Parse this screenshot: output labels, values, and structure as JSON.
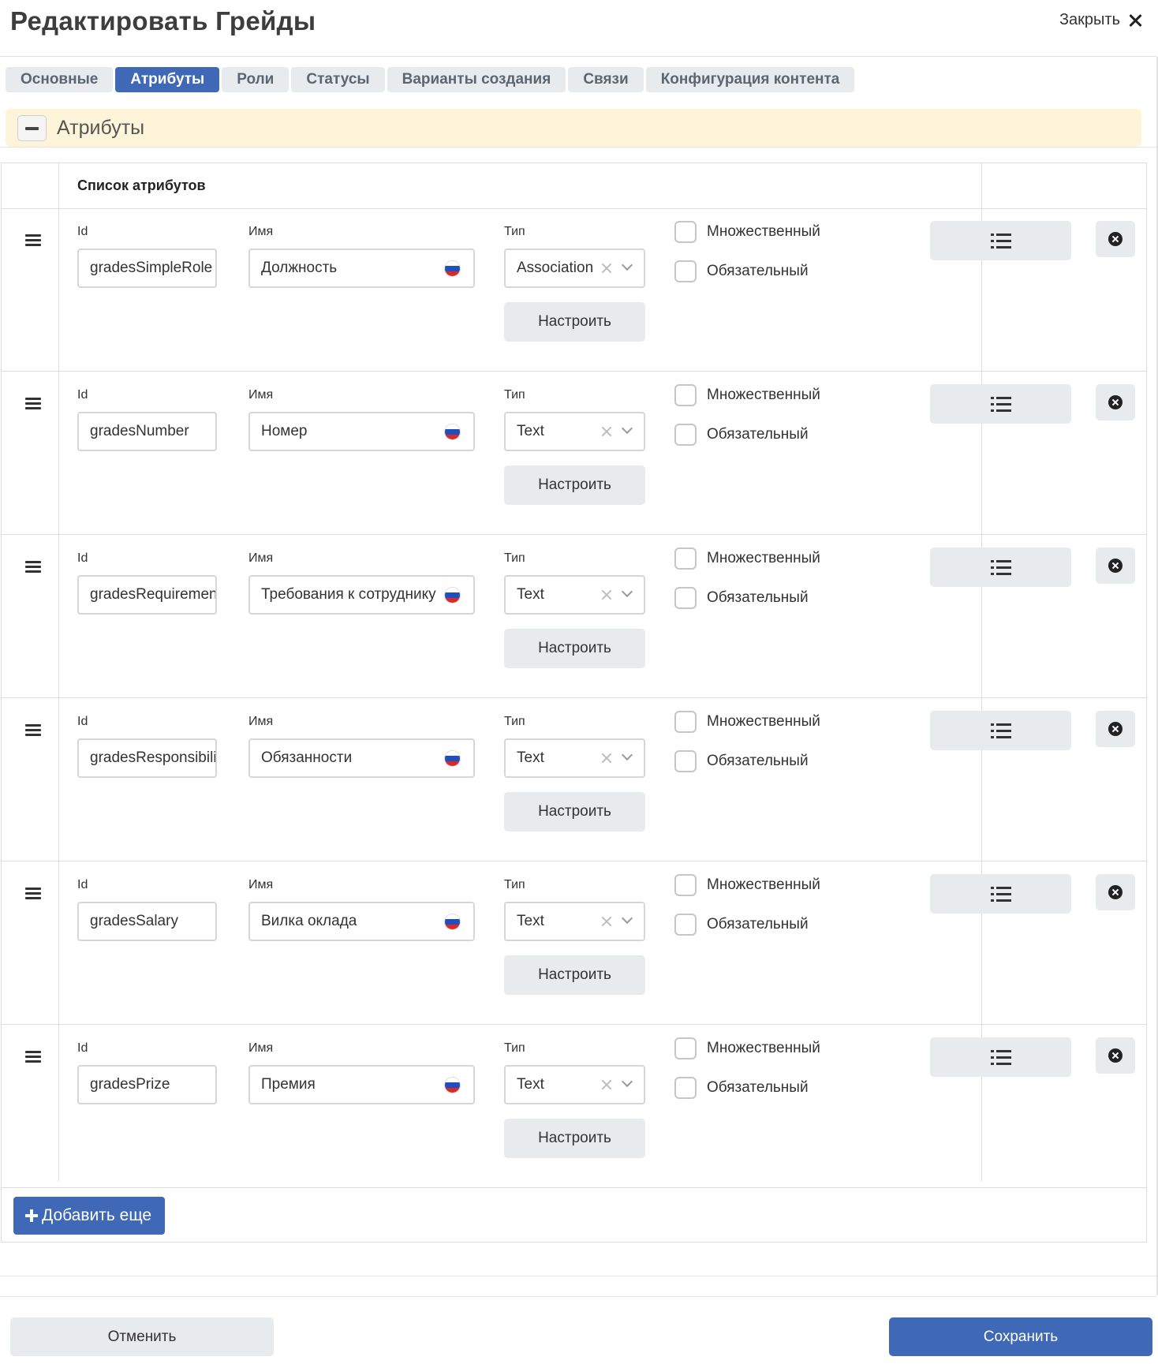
{
  "header": {
    "title": "Редактировать Грейды",
    "close_label": "Закрыть"
  },
  "tabs": [
    {
      "label": "Основные",
      "active": false
    },
    {
      "label": "Атрибуты",
      "active": true
    },
    {
      "label": "Роли",
      "active": false
    },
    {
      "label": "Статусы",
      "active": false
    },
    {
      "label": "Варианты создания",
      "active": false
    },
    {
      "label": "Связи",
      "active": false
    },
    {
      "label": "Конфигурация контента",
      "active": false
    }
  ],
  "section": {
    "title": "Атрибуты"
  },
  "table": {
    "header": "Список атрибутов",
    "labels": {
      "id": "Id",
      "name": "Имя",
      "type": "Тип",
      "configure": "Настроить",
      "multiple": "Множественный",
      "required": "Обязательный"
    },
    "rows": [
      {
        "id": "gradesSimpleRole",
        "name": "Должность",
        "type": "Association",
        "multiple": false,
        "required": false
      },
      {
        "id": "gradesNumber",
        "name": "Номер",
        "type": "Text",
        "multiple": false,
        "required": false
      },
      {
        "id": "gradesRequirements",
        "name": "Требования к сотруднику",
        "type": "Text",
        "multiple": false,
        "required": false
      },
      {
        "id": "gradesResponsibilities",
        "name": "Обязанности",
        "type": "Text",
        "multiple": false,
        "required": false
      },
      {
        "id": "gradesSalary",
        "name": "Вилка оклада",
        "type": "Text",
        "multiple": false,
        "required": false
      },
      {
        "id": "gradesPrize",
        "name": "Премия",
        "type": "Text",
        "multiple": false,
        "required": false
      }
    ],
    "add_label": "Добавить еще"
  },
  "footer": {
    "cancel_label": "Отменить",
    "save_label": "Сохранить"
  },
  "colors": {
    "primary": "#3f69b6",
    "section_bg": "#fdf4d9",
    "button_bg": "#e8ebee"
  },
  "icons": {
    "close": "close-icon",
    "collapse": "minus-icon",
    "drag": "drag-handle-icon",
    "flag": "russian-flag-icon",
    "clear": "clear-icon",
    "chevron": "chevron-down-icon",
    "list": "list-icon",
    "delete": "delete-icon",
    "add": "plus-icon"
  }
}
